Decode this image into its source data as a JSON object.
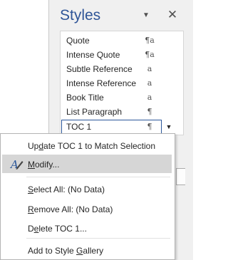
{
  "pane": {
    "title": "Styles",
    "menu_icon": "caret-down-icon",
    "close_icon": "close-icon",
    "styles": [
      {
        "name": "Quote",
        "symbol": "¶a"
      },
      {
        "name": "Intense Quote",
        "symbol": "¶a"
      },
      {
        "name": "Subtle Reference",
        "symbol": "a"
      },
      {
        "name": "Intense Reference",
        "symbol": "a"
      },
      {
        "name": "Book Title",
        "symbol": "a"
      },
      {
        "name": "List Paragraph",
        "symbol": "¶"
      },
      {
        "name": "TOC 1",
        "symbol": "¶",
        "selected": true
      }
    ]
  },
  "context_menu": {
    "items": [
      {
        "pre": "Up",
        "key": "d",
        "post": "ate TOC 1 to Match Selection"
      },
      {
        "pre": "",
        "key": "M",
        "post": "odify...",
        "icon": "modify-style-icon",
        "hover": true
      },
      {
        "pre": "",
        "key": "S",
        "post": "elect All: (No Data)"
      },
      {
        "pre": "",
        "key": "R",
        "post": "emove All: (No Data)"
      },
      {
        "pre": "D",
        "key": "e",
        "post": "lete TOC 1..."
      },
      {
        "pre": "Add to Style ",
        "key": "G",
        "post": "allery"
      }
    ]
  },
  "colors": {
    "title": "#2f5597",
    "hover": "#d6d6d6",
    "selected_border": "#2b579a"
  }
}
